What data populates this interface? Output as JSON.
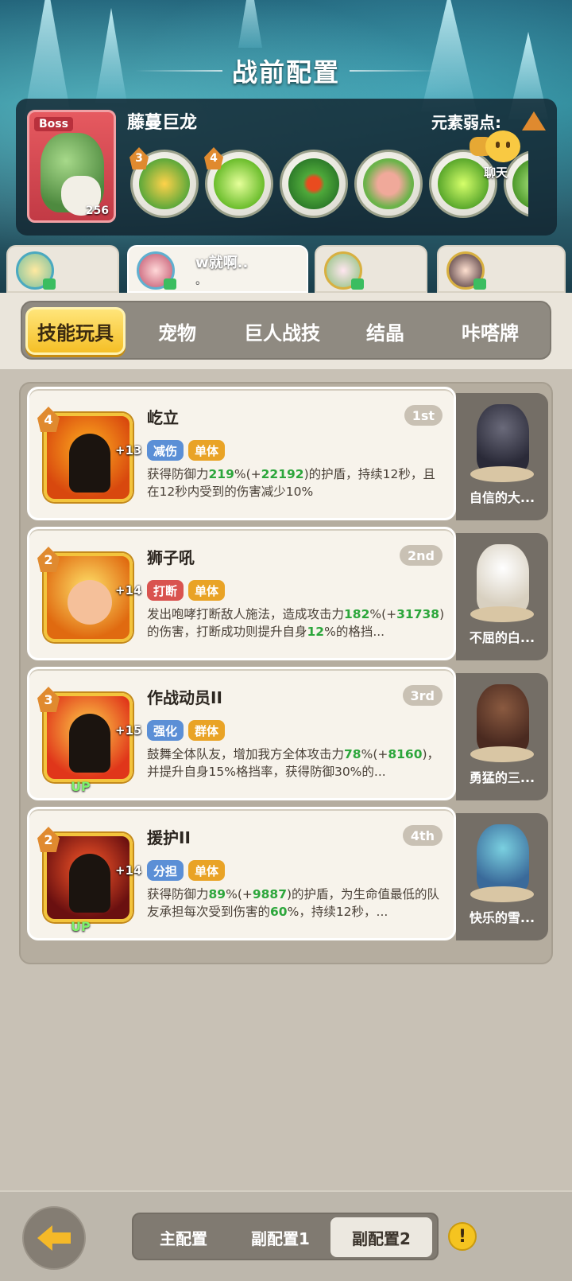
{
  "header": {
    "title": "战前配置",
    "boss": {
      "tag": "Boss",
      "name": "藤蔓巨龙",
      "level": "256",
      "weakness_label": "元素弱点:",
      "skills": [
        {
          "badge": "3",
          "icon": "green-dragon-skill-icon"
        },
        {
          "badge": "4",
          "icon": "green-flame-skill-icon"
        },
        {
          "badge": "",
          "icon": "blood-drop-skill-icon"
        },
        {
          "badge": "",
          "icon": "boar-skill-icon"
        },
        {
          "badge": "",
          "icon": "green-slime-skill-icon"
        }
      ]
    },
    "chat_label": "聊天"
  },
  "team": [
    {
      "name": "",
      "sub": "",
      "active": false
    },
    {
      "name": "w就啊..",
      "sub": "。",
      "active": true
    },
    {
      "name": "",
      "sub": "",
      "active": false
    },
    {
      "name": "",
      "sub": "",
      "active": false
    }
  ],
  "tabs": [
    "技能玩具",
    "宠物",
    "巨人战技",
    "结晶",
    "咔嗒牌"
  ],
  "active_tab": 0,
  "skills": [
    {
      "level": "4",
      "plus": "+13",
      "up": "",
      "name": "屹立",
      "rank": "1st",
      "tag1": "减伤",
      "tag1_color": "#5b8fd6",
      "tag2": "单体",
      "desc_parts": [
        "获得防御力",
        "219",
        "%(+",
        "22192",
        ")的护盾，持续12秒，且在12秒内受到的伤害减少10%"
      ],
      "pet_name": "自信的大..."
    },
    {
      "level": "2",
      "plus": "+14",
      "up": "",
      "name": "狮子吼",
      "rank": "2nd",
      "tag1": "打断",
      "tag1_color": "#d9534f",
      "tag2": "单体",
      "desc_parts": [
        "发出咆哮打断敌人施法，造成攻击力",
        "182",
        "%(+",
        "31738",
        ")的伤害，打断成功则提升自身",
        "12",
        "%的格挡..."
      ],
      "pet_name": "不屈的白..."
    },
    {
      "level": "3",
      "plus": "+15",
      "up": "UP",
      "name": "作战动员II",
      "rank": "3rd",
      "tag1": "强化",
      "tag1_color": "#5b8fd6",
      "tag2": "群体",
      "desc_parts": [
        "鼓舞全体队友，增加我方全体攻击力",
        "78",
        "%(+",
        "8160",
        ")，并提升自身15%格挡率，获得防御30%的..."
      ],
      "pet_name": "勇猛的三..."
    },
    {
      "level": "2",
      "plus": "+14",
      "up": "UP",
      "name": "援护II",
      "rank": "4th",
      "tag1": "分担",
      "tag1_color": "#5b8fd6",
      "tag2": "单体",
      "desc_parts": [
        "获得防御力",
        "89",
        "%(+",
        "9887",
        ")的护盾，为生命值最低的队友承担每次受到伤害的",
        "60",
        "%，持续12秒，..."
      ],
      "pet_name": "快乐的雪..."
    }
  ],
  "bottom": {
    "configs": [
      "主配置",
      "副配置1",
      "副配置2"
    ],
    "active_config": 2,
    "warn_symbol": "!"
  }
}
